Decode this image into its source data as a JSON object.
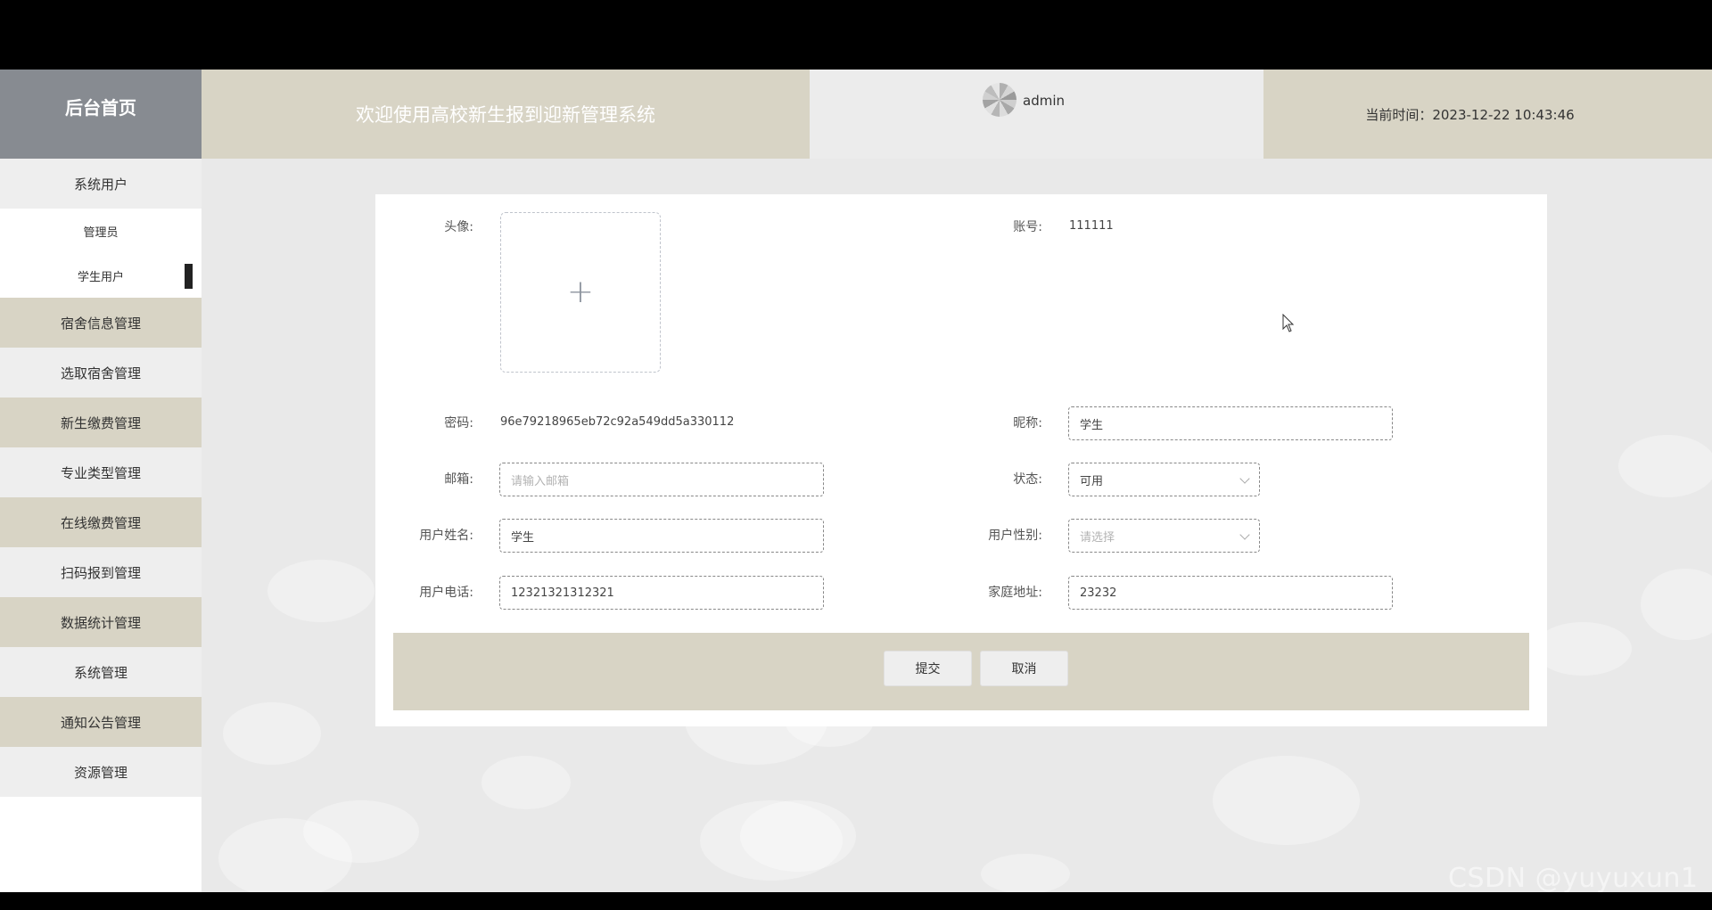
{
  "header": {
    "home_label": "后台首页",
    "system_title": "欢迎使用高校新生报到迎新管理系统",
    "username": "admin",
    "current_time": "当前时间：2023-12-22 10:43:46"
  },
  "sidebar": {
    "group_system_users": "系统用户",
    "sub_items": [
      "管理员",
      "学生用户"
    ],
    "items": [
      "宿舍信息管理",
      "选取宿舍管理",
      "新生缴费管理",
      "专业类型管理",
      "在线缴费管理",
      "扫码报到管理",
      "数据统计管理",
      "系统管理",
      "通知公告管理",
      "资源管理"
    ]
  },
  "form": {
    "avatar_label": "头像:",
    "account_label": "账号:",
    "account_value": "111111",
    "password_label": "密码:",
    "password_value": "96e79218965eb72c92a549dd5a330112",
    "nickname_label": "昵称:",
    "nickname_value": "学生",
    "email_label": "邮箱:",
    "email_placeholder": "请输入邮箱",
    "status_label": "状态:",
    "status_value": "可用",
    "name_label": "用户姓名:",
    "name_value": "学生",
    "gender_label": "用户性别:",
    "gender_placeholder": "请选择",
    "phone_label": "用户电话:",
    "phone_value": "12321321312321",
    "address_label": "家庭地址:",
    "address_value": "23232",
    "submit_label": "提交",
    "cancel_label": "取消"
  },
  "watermark": "CSDN @yuyuxun1",
  "colors": {
    "tan": "#d8d4c5",
    "home_bg": "#878b91",
    "content_bg": "#e9e9e9"
  }
}
